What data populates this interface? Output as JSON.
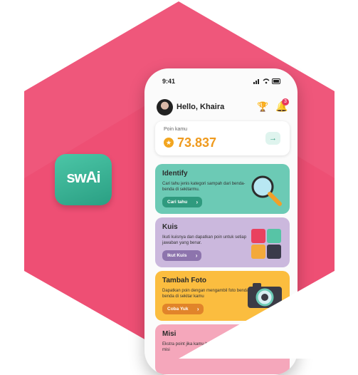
{
  "app_icon": {
    "wordmark": "swAi"
  },
  "phone": {
    "status_time": "9:41",
    "greeting": "Hello, Khaira",
    "notification_count": "3",
    "points": {
      "label": "Poin kamu",
      "value": "73.837",
      "arrow": "→"
    },
    "cards": [
      {
        "title": "Identify",
        "description": "Cari tahu jenis kategori sampah dari benda-benda di sekitarmu.",
        "button": "Cari tahu",
        "icon": "magnifier-icon"
      },
      {
        "title": "Kuis",
        "description": "Ikuti kuisnya dan dapatkan poin untuk setiap jawaban yang benar.",
        "button": "Ikut Kuis",
        "icon": "puzzle-icon"
      },
      {
        "title": "Tambah Foto",
        "description": "Dapatkan poin dengan mengambil foto benda-benda di sekitar kamu",
        "button": "Coba Yuk",
        "icon": "camera-icon"
      },
      {
        "title": "Misi",
        "description": "Ekstra point jika kamu berhasil menyelesaikan misi",
        "button": "",
        "icon": ""
      }
    ]
  },
  "colors": {
    "hex_bg": "#ee4f74",
    "identify": "#6ccab5",
    "kuis": "#cbb8dd",
    "foto": "#fbbd3f",
    "misi": "#f5a7bb"
  }
}
